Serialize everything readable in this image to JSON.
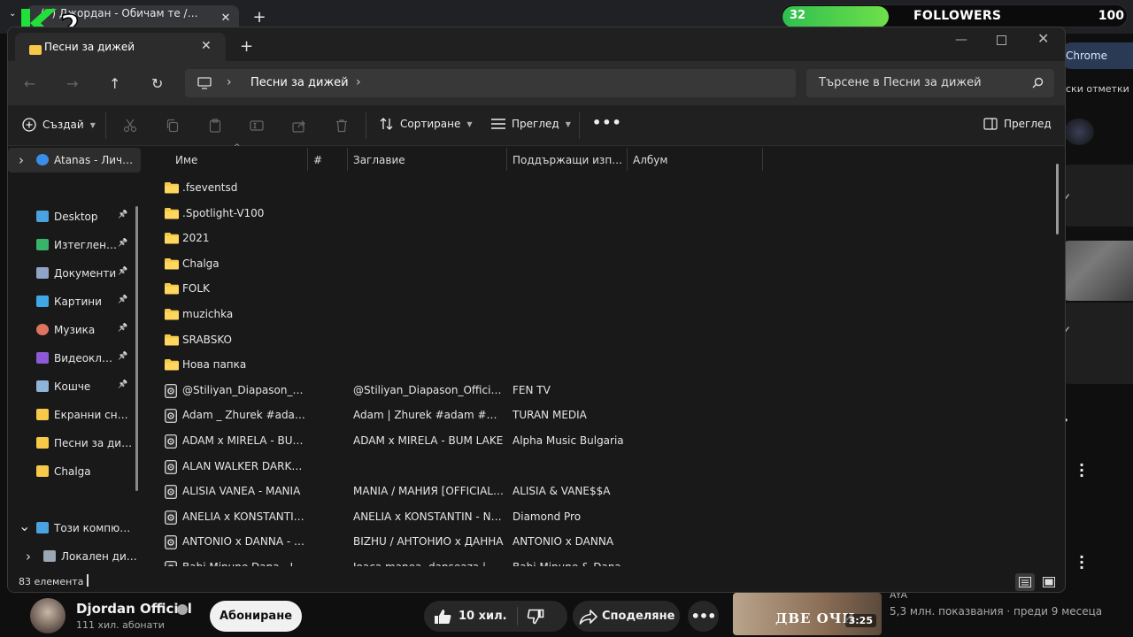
{
  "browser": {
    "tab_title": "(7) Джордан - Обичам те / Dj",
    "profile_label": "Chrome",
    "bookmarks_label": "ски отметки"
  },
  "overlay": {
    "logo_text": "K2",
    "followers_count": "32",
    "followers_label": "FOLLOWERS",
    "followers_goal": "100",
    "followers_progress": 0.32
  },
  "explorer": {
    "tab_title": "Песни за дижей",
    "address_crumb": "Песни за дижей",
    "search_placeholder": "Търсене в Песни за дижей",
    "toolbar": {
      "new_label": "Създай",
      "sort_label": "Сортиране",
      "view_label": "Преглед",
      "details_label": "Преглед"
    },
    "nav_pane": [
      {
        "label": "Atanas - Личен",
        "icon": "onedrive-icon",
        "color": "#3b8ee8",
        "expander": "›",
        "pinned": false
      },
      {
        "label": "Desktop",
        "icon": "desktop-icon",
        "color": "#4aa3e0",
        "expander": "",
        "pinned": true
      },
      {
        "label": "Изтеглени файлове",
        "icon": "download-icon",
        "color": "#39b36a",
        "expander": "",
        "pinned": true
      },
      {
        "label": "Документи",
        "icon": "documents-icon",
        "color": "#8fa4c7",
        "expander": "",
        "pinned": true
      },
      {
        "label": "Картини",
        "icon": "pictures-icon",
        "color": "#3fa7e6",
        "expander": "",
        "pinned": true
      },
      {
        "label": "Музика",
        "icon": "music-icon",
        "color": "#e0735f",
        "expander": "",
        "pinned": true
      },
      {
        "label": "Видеоклипове",
        "icon": "videos-icon",
        "color": "#8c5ad6",
        "expander": "",
        "pinned": true
      },
      {
        "label": "Кошче",
        "icon": "recycle-bin-icon",
        "color": "#8fb3d9",
        "expander": "",
        "pinned": true
      },
      {
        "label": "Екранни снимки",
        "icon": "folder-icon",
        "color": "#f7c948",
        "expander": "",
        "pinned": false
      },
      {
        "label": "Песни за дижей",
        "icon": "folder-icon",
        "color": "#f7c948",
        "expander": "",
        "pinned": false
      },
      {
        "label": "Chalga",
        "icon": "folder-icon",
        "color": "#f7c948",
        "expander": "",
        "pinned": false
      },
      {
        "label": "Този компютър",
        "icon": "this-pc-icon",
        "color": "#4aa3e0",
        "expander": "⌄",
        "pinned": false
      },
      {
        "label": "Локален диск (C:)",
        "icon": "drive-icon",
        "color": "#9aa7b5",
        "expander": "›",
        "pinned": false
      }
    ],
    "columns": {
      "name": "Име",
      "number": "#",
      "title": "Заглавие",
      "artists": "Поддържащи изпълнители",
      "album": "Албум"
    },
    "files": [
      {
        "name": ".fseventsd",
        "type": "folder",
        "title": "",
        "artist": ""
      },
      {
        "name": ".Spotlight-V100",
        "type": "folder",
        "title": "",
        "artist": ""
      },
      {
        "name": "2021",
        "type": "folder",
        "title": "",
        "artist": ""
      },
      {
        "name": "Chalga",
        "type": "folder",
        "title": "",
        "artist": ""
      },
      {
        "name": "FOLK",
        "type": "folder",
        "title": "",
        "artist": ""
      },
      {
        "name": "muzichka",
        "type": "folder",
        "title": "",
        "artist": ""
      },
      {
        "name": "SRABSKO",
        "type": "folder",
        "title": "",
        "artist": ""
      },
      {
        "name": "Нова папка",
        "type": "folder",
        "title": "",
        "artist": ""
      },
      {
        "name": "@Stiliyan_Diapason_Official",
        "type": "audio",
        "title": "@Stiliyan_Diapason_Official & FEN TV",
        "artist": "FEN TV"
      },
      {
        "name": "Adam _ Zhurek #adam #Zhurek",
        "type": "audio",
        "title": "Adam | Zhurek #adam #Zhurek",
        "artist": "TURAN MEDIA"
      },
      {
        "name": "ADAM x MIRELA - BUM LAKE",
        "type": "audio",
        "title": "ADAM x MIRELA - BUM LAKE",
        "artist": "Alpha Music Bulgaria"
      },
      {
        "name": "ALAN WALKER DARKNESS",
        "type": "audio",
        "title": "",
        "artist": ""
      },
      {
        "name": "ALISIA  VANEA - MANIA",
        "type": "audio",
        "title": "MANIA / МАНИЯ [OFFICIAL VIDEO]",
        "artist": "ALISIA & VANE$$A"
      },
      {
        "name": "ANELIA x KONSTANTIN - NYAMA",
        "type": "audio",
        "title": "ANELIA x KONSTANTIN - NYAMA",
        "artist": "Diamond Pro"
      },
      {
        "name": "ANTONIO x DANNA - BIZHU",
        "type": "audio",
        "title": "BIZHU /  АНТОНИО x ДАННА",
        "artist": "ANTONIO x DANNA"
      },
      {
        "name": "Babi Minune Dana - Joaca",
        "type": "audio",
        "title": "Joaca manea, danseaza | wW",
        "artist": "Babi Minune & Dana"
      }
    ],
    "status_count": "83 елемента"
  },
  "youtube": {
    "channel_name": "Djordan Official",
    "subscribers": "111 хил. абонати",
    "subscribe_label": "Абониране",
    "like_count": "10 хил.",
    "share_label": "Споделяне",
    "related_thumb_text": "ДВЕ ОЧИ",
    "related_duration": "3:25",
    "related_channel": "AYA",
    "related_meta": "5,3 млн. показвания · преди 9 месеца"
  }
}
